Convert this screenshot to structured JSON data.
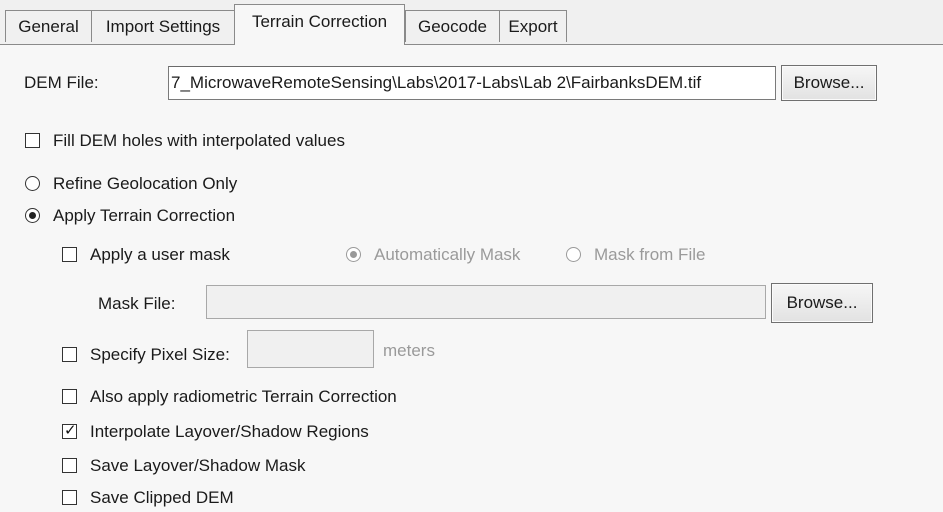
{
  "tabs": [
    {
      "label": "General",
      "active": false
    },
    {
      "label": "Import Settings",
      "active": false
    },
    {
      "label": "Terrain Correction",
      "active": true
    },
    {
      "label": "Geocode",
      "active": false
    },
    {
      "label": "Export",
      "active": false
    }
  ],
  "dem": {
    "label": "DEM File:",
    "value": "7_MicrowaveRemoteSensing\\Labs\\2017-Labs\\Lab 2\\FairbanksDEM.tif",
    "browse_label": "Browse..."
  },
  "fill_holes": {
    "label": "Fill DEM holes with interpolated values",
    "checked": false
  },
  "mode": {
    "refine_label": "Refine Geolocation Only",
    "apply_label": "Apply Terrain Correction",
    "selected": "apply"
  },
  "user_mask": {
    "label": "Apply a user mask",
    "checked": false,
    "auto_label": "Automatically Mask",
    "file_label": "Mask from File",
    "selected": "auto"
  },
  "mask_file": {
    "label": "Mask File:",
    "value": "",
    "browse_label": "Browse..."
  },
  "pixel_size": {
    "label": "Specify Pixel Size:",
    "value": "",
    "unit": "meters",
    "checked": false
  },
  "radiometric": {
    "label": "Also apply radiometric Terrain Correction",
    "checked": false
  },
  "interpolate": {
    "label": "Interpolate Layover/Shadow Regions",
    "checked": true,
    "check_glyph": "✓"
  },
  "save_mask": {
    "label": "Save Layover/Shadow Mask",
    "checked": false
  },
  "save_dem": {
    "label": "Save Clipped DEM",
    "checked": false
  }
}
